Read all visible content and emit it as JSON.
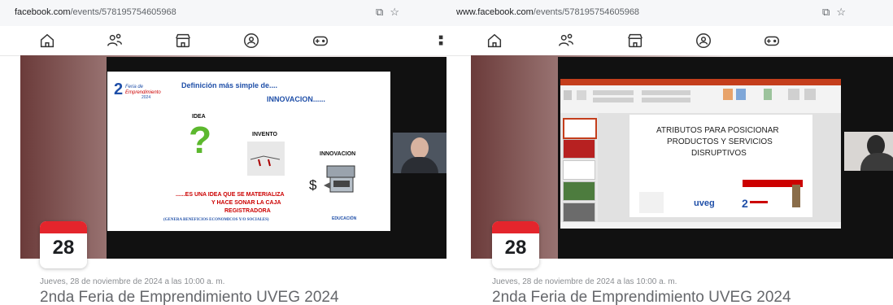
{
  "left": {
    "url_host": "facebook.com",
    "url_path": "/events/578195754605968",
    "slide": {
      "heading": "Definición más simple de....",
      "title": "INNOVACION......",
      "idea_label": "IDEA",
      "invento_label": "INVENTO",
      "innovacion_label": "INNOVACION",
      "dollar": "$",
      "statement_line1": "......ES UNA IDEA QUE SE MATERIALIZA",
      "statement_line2": "Y HACE SONAR LA CAJA",
      "statement_line3": "REGISTRADORA",
      "footnote": "(GENERA BENEFICIOS ECONOMICOS Y/O SOCIALES)",
      "logo_text": "EDUCACIÓN"
    },
    "event": {
      "day": "28",
      "date_text": "Jueves, 28 de noviembre de 2024 a las 10:00 a. m.",
      "title": "2nda Feria de Emprendimiento UVEG 2024"
    }
  },
  "right": {
    "url_host": "www.facebook.com",
    "url_path": "/events/578195754605968",
    "slide": {
      "title_line1": "ATRIBUTOS PARA POSICIONAR",
      "title_line2": "PRODUCTOS Y SERVICIOS",
      "title_line3": "DISRUPTIVOS",
      "logo": "uveg"
    },
    "event": {
      "day": "28",
      "date_text": "Jueves, 28 de noviembre de 2024 a las 10:00 a. m.",
      "title": "2nda Feria de Emprendimiento UVEG 2024"
    }
  },
  "nav_icons": [
    "home-icon",
    "friends-icon",
    "marketplace-icon",
    "groups-icon",
    "gaming-icon"
  ],
  "colors": {
    "accent_red": "#e4252c",
    "slide_red": "#cc0000",
    "slide_blue": "#1f4fa8",
    "ppt_orange": "#c43e1c"
  }
}
